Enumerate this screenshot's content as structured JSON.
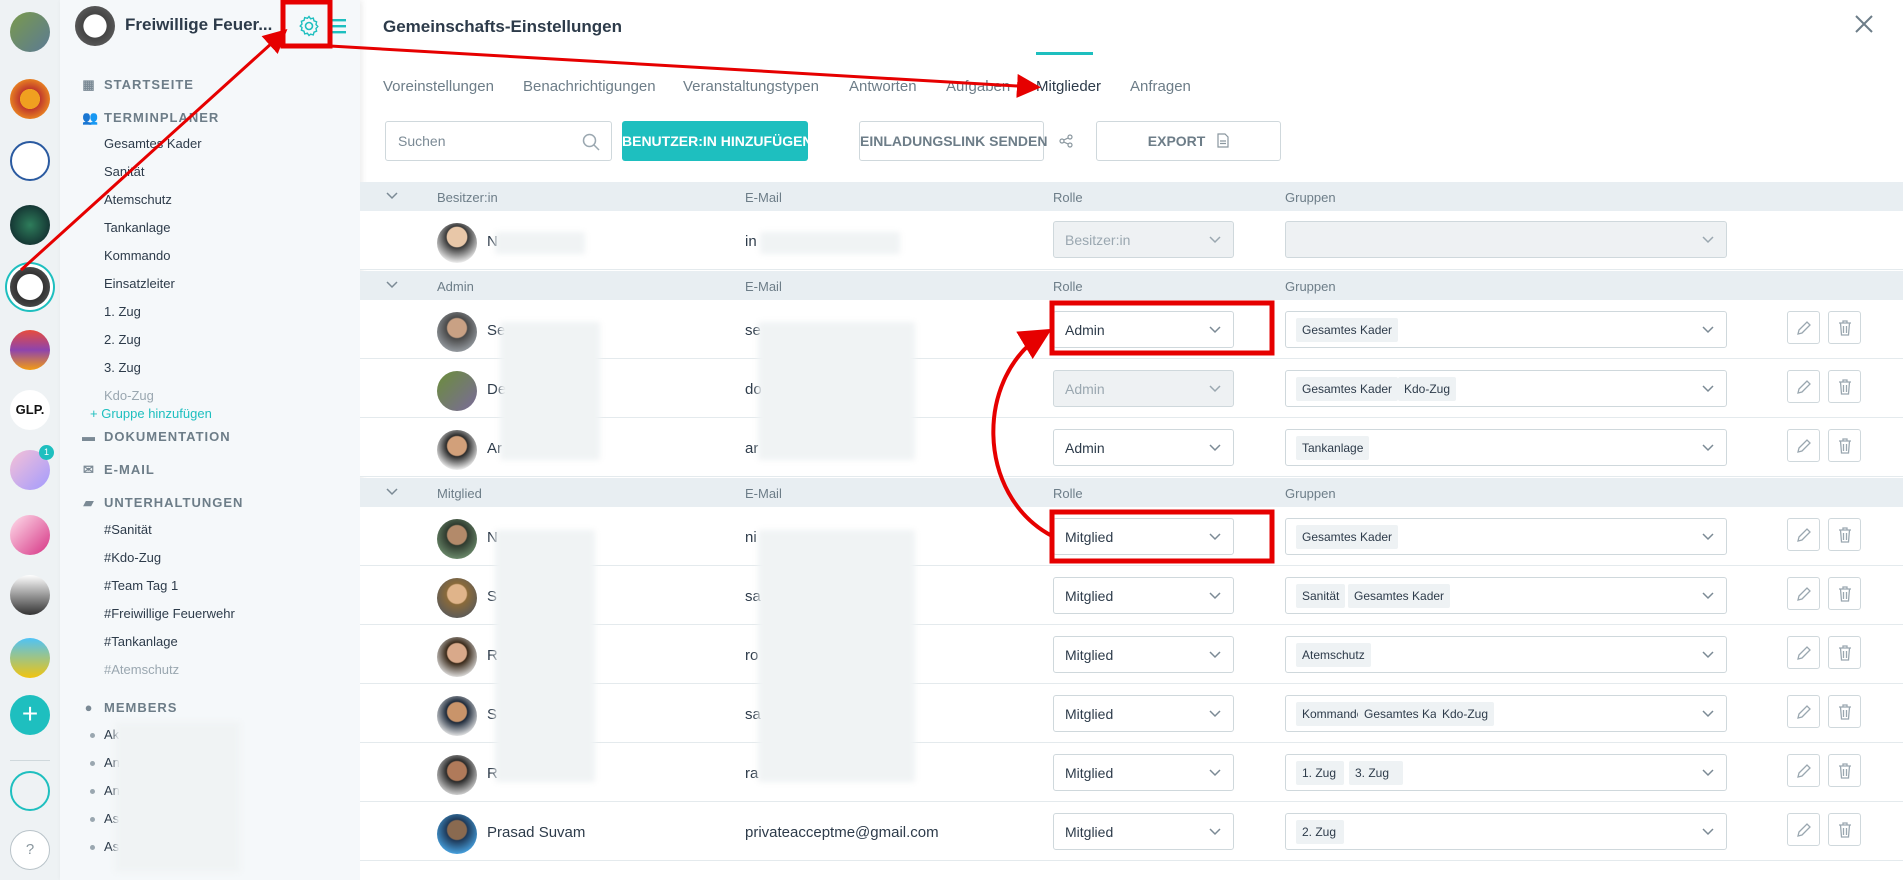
{
  "sidebar": {
    "community_name": "Freiwillige Feuer...",
    "sections": {
      "start": "STARTSEITE",
      "planner": "TERMINPLANER",
      "docs": "DOKUMENTATION",
      "email": "E-MAIL",
      "chats": "UNTERHALTUNGEN",
      "members": "MEMBERS"
    },
    "planner_groups": [
      "Gesamtes Kader",
      "Sanität",
      "Atemschutz",
      "Tankanlage",
      "Kommando",
      "Einsatzleiter",
      "1. Zug",
      "2. Zug",
      "3. Zug",
      "Kdo-Zug"
    ],
    "add_group": "Gruppe hinzufügen",
    "channels": [
      "#Sanität",
      "#Kdo-Zug",
      "#Team Tag 1",
      "#Freiwillige Feuerwehr",
      "#Tankanlage",
      "#Atemschutz"
    ],
    "members": [
      "Ak",
      "An",
      "An",
      "As",
      "As"
    ],
    "rail_badge": "1"
  },
  "main": {
    "title": "Gemeinschafts-Einstellungen",
    "tabs": [
      "Voreinstellungen",
      "Benachrichtigungen",
      "Veranstaltungstypen",
      "Antworten",
      "Aufgaben",
      "Mitglieder",
      "Anfragen"
    ],
    "search_placeholder": "Suchen",
    "add_user": "BENUTZER:IN HINZUFÜGEN",
    "invite": "EINLADUNGSLINK SENDEN",
    "export": "EXPORT",
    "columns": {
      "email": "E-Mail",
      "role": "Rolle",
      "groups": "Gruppen"
    },
    "owner_group": "Besitzer:in",
    "admin_group": "Admin",
    "member_group": "Mitglied",
    "owner_row": {
      "name": "N",
      "email": "in",
      "role": "Besitzer:in"
    },
    "admin_rows": [
      {
        "name": "Se",
        "email": "se",
        "role": "Admin",
        "groups": [
          "Gesamtes Kader"
        ]
      },
      {
        "name": "De",
        "email": "do",
        "role": "Admin",
        "groups": [
          "Gesamtes Kader",
          "Kdo-Zug"
        ]
      },
      {
        "name": "Ar",
        "email": "ar",
        "role": "Admin",
        "groups": [
          "Tankanlage"
        ]
      }
    ],
    "member_rows": [
      {
        "name": "N",
        "email": "ni",
        "role": "Mitglied",
        "groups": [
          "Gesamtes Kader"
        ]
      },
      {
        "name": "S",
        "email": "sa",
        "role": "Mitglied",
        "groups": [
          "Sanität",
          "Gesamtes Kader"
        ]
      },
      {
        "name": "R",
        "email": "ro",
        "role": "Mitglied",
        "groups": [
          "Atemschutz"
        ]
      },
      {
        "name": "S",
        "email": "sa",
        "role": "Mitglied",
        "groups": [
          "Kommando",
          "Gesamtes Kader",
          "Kdo-Zug"
        ]
      },
      {
        "name": "R",
        "email": "ra",
        "role": "Mitglied",
        "groups": [
          "1. Zug",
          "3. Zug"
        ]
      },
      {
        "name": "Prasad Suvam",
        "email": "privateacceptme@gmail.com",
        "role": "Mitglied",
        "groups": [
          "2. Zug"
        ]
      }
    ]
  },
  "colors": {
    "accent": "#1ebfbf",
    "annotation": "#e60000"
  }
}
